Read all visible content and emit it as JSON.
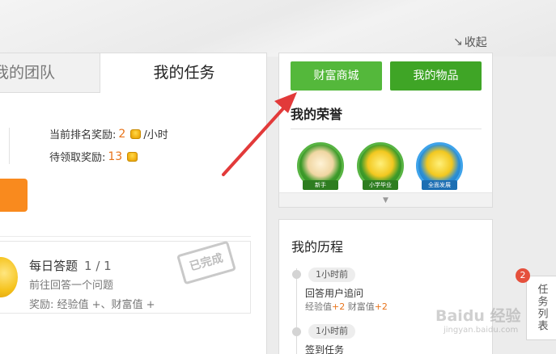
{
  "header": {
    "collapse_label": "收起"
  },
  "tabs": {
    "team_label": "我的团队",
    "task_label": "我的任务"
  },
  "rewards": {
    "rank_label": "当前排名奖励:",
    "rank_value": "2",
    "rank_unit": "/小时",
    "pending_label": "待领取奖励:",
    "pending_value": "13"
  },
  "daily_task": {
    "title": "每日答题",
    "progress": "1 / 1",
    "description": "前往回答一个问题",
    "reward_text": "奖励: 经验值 +、财富值 +",
    "stamp_label": "已完成"
  },
  "side": {
    "mall_button": "财富商城",
    "items_button": "我的物品",
    "honor_title": "我的荣誉",
    "medals": [
      {
        "name": "新手",
        "ribbon": "新手"
      },
      {
        "name": "小学毕业",
        "ribbon": "小学毕业"
      },
      {
        "name": "全面发展",
        "ribbon": "全面发展"
      }
    ]
  },
  "history": {
    "title": "我的历程",
    "entries": [
      {
        "time": "1小时前",
        "action": "回答用户追问",
        "exp_label": "经验值",
        "exp_value": "+2",
        "wealth_label": "财富值",
        "wealth_value": "+2"
      },
      {
        "time": "1小时前",
        "action": "签到任务"
      }
    ]
  },
  "task_list_tab": {
    "label": "任务列表",
    "badge": "2"
  },
  "watermark": {
    "brand": "Baidu 经验",
    "url": "jingyan.baidu.com"
  },
  "colors": {
    "accent_green": "#4aae31",
    "accent_orange": "#f98a1e",
    "arrow_red": "#e23a3a"
  }
}
